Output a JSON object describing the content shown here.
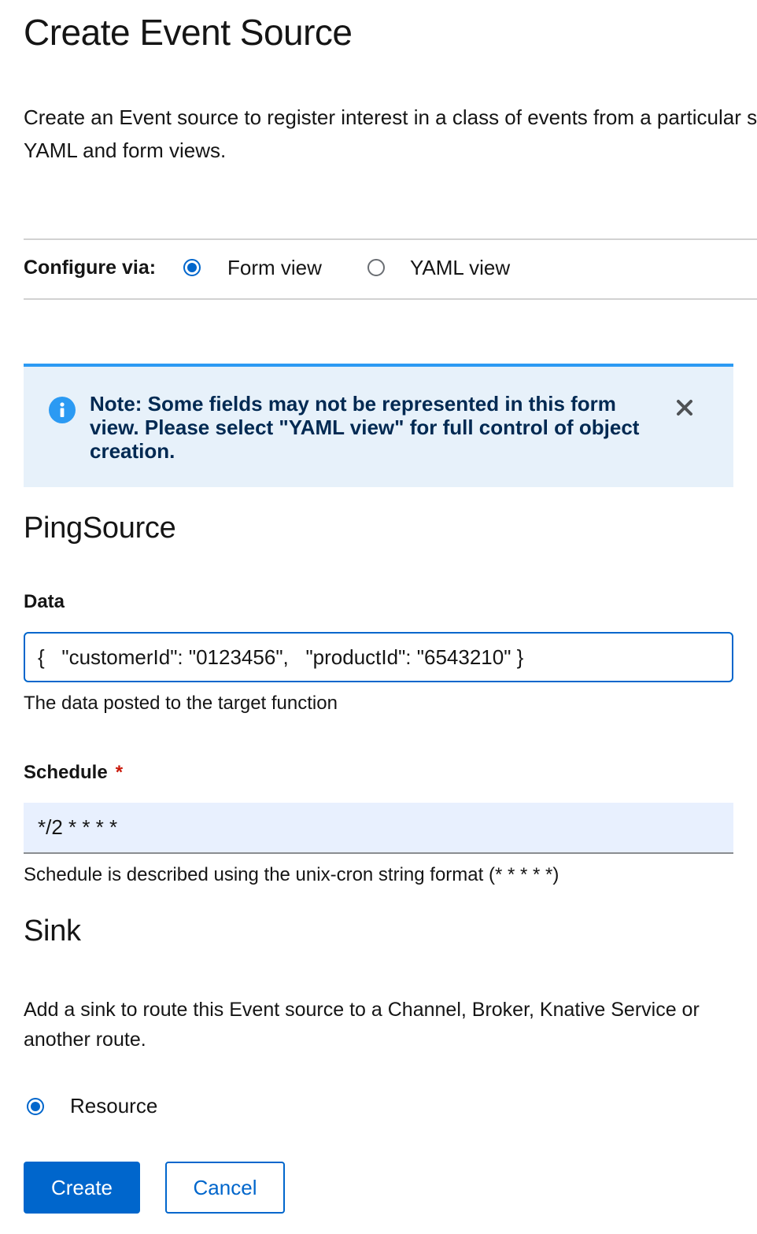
{
  "page": {
    "title": "Create Event Source",
    "intro_line1": "Create an Event source to register interest in a class of events from a particular system. Configure using the",
    "intro_line2": "YAML and form views."
  },
  "configure": {
    "label": "Configure via:",
    "options": [
      {
        "label": "Form view",
        "selected": true
      },
      {
        "label": "YAML view",
        "selected": false
      }
    ]
  },
  "alert": {
    "text": "Note: Some fields may not be represented in this form view. Please select \"YAML view\" for full control of object creation.",
    "icon": "info-icon",
    "close_icon": "close-icon",
    "color": "#2b9af3"
  },
  "ping_source": {
    "heading": "PingSource",
    "data_label": "Data",
    "data_value": "{   \"customerId\": \"0123456\",   \"productId\": \"6543210\" }",
    "data_helper": "The data posted to the target function",
    "schedule_label": "Schedule",
    "schedule_required": "*",
    "schedule_value": "*/2 * * * *",
    "schedule_helper": "Schedule is described using the unix-cron string format (* * * * *)"
  },
  "sink": {
    "heading": "Sink",
    "description": "Add a sink to route this Event source to a Channel, Broker, Knative Service or another route.",
    "option_label": "Resource",
    "option_selected": true
  },
  "actions": {
    "create_label": "Create",
    "cancel_label": "Cancel",
    "primary_color": "#0066cc"
  }
}
